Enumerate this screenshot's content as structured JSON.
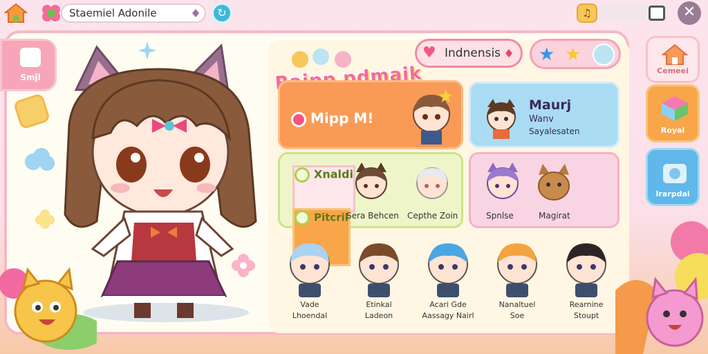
{
  "topbar": {
    "search_value": "Staemiel Adonile",
    "close_label": "✕"
  },
  "left_side": {
    "shop_label": "Smjl"
  },
  "game": {
    "title": "Raipp pdmaik",
    "region": "Indnensis",
    "featured_label": "Mipp M!",
    "blue_card": {
      "title": "Maurj",
      "subtitle": "Wanv",
      "caption": "Sayalesaten"
    },
    "green_card": {
      "row1": "Xnaldi",
      "row2": "Pitcril",
      "names": [
        "Sera Behcen",
        "Cepthe Zoin"
      ]
    },
    "pink_card": {
      "names": [
        "Spnlse",
        "Magirat"
      ]
    },
    "roster": [
      {
        "line1": "Vade",
        "line2": "Lhoendal",
        "hair": "#a9d3ef",
        "face": "#ffe3d3"
      },
      {
        "line1": "Etinkal",
        "line2": "Ladeon",
        "hair": "#7a4b2a",
        "face": "#ffe3d3"
      },
      {
        "line1": "Acari Gde",
        "line2": "Aassagy Nairl",
        "hair": "#4aa6e3",
        "face": "#ffe3d3"
      },
      {
        "line1": "Nanaltuel",
        "line2": "Soe",
        "hair": "#f3a33f",
        "face": "#ffe3d3"
      },
      {
        "line1": "Rearnine",
        "line2": "Stoupt",
        "hair": "#2d2424",
        "face": "#ffe3d3"
      }
    ]
  },
  "right_side": {
    "btn1": "Cemeei",
    "btn2": "Royal",
    "btn3": "Irarpdai"
  },
  "colors": {
    "accent_pink": "#f4b9c6",
    "accent_orange": "#f99a56",
    "accent_blue": "#a9dcf3",
    "accent_green": "#eef6c9"
  }
}
